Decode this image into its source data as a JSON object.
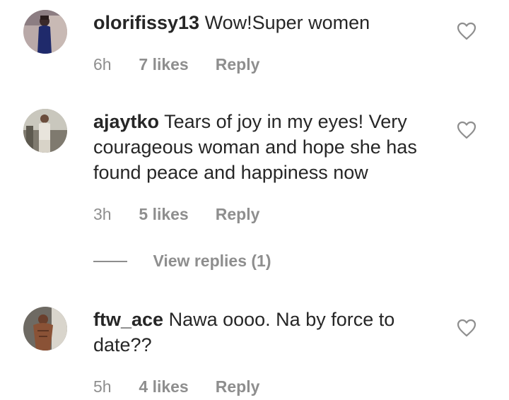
{
  "comments": [
    {
      "username": "olorifissy13",
      "text": "Wow!Super women",
      "time": "6h",
      "likes": "7 likes",
      "reply": "Reply"
    },
    {
      "username": "ajaytko",
      "text": "Tears of joy in my eyes! Very courageous woman and hope she has found peace and happiness now",
      "time": "3h",
      "likes": "5 likes",
      "reply": "Reply",
      "view_replies": "View replies (1)"
    },
    {
      "username": "ftw_ace",
      "text": "Nawa oooo. Na by force to date??",
      "time": "5h",
      "likes": "4 likes",
      "reply": "Reply"
    }
  ],
  "icons": {
    "like": "heart-outline-icon",
    "avatar": "profile-photo"
  },
  "colors": {
    "text": "#262626",
    "muted": "#8e8e8e",
    "background": "#ffffff"
  }
}
